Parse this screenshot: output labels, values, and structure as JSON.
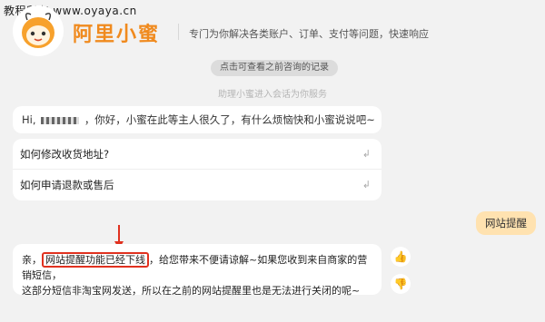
{
  "watermark": "教程所有 www.oyaya.cn",
  "header": {
    "brand": "阿里小蜜",
    "tagline": "专门为你解决各类账户、订单、支付等问题，快速响应"
  },
  "history_button": "点击可查看之前咨询的记录",
  "system_note": "助理小蜜进入会话为你服务",
  "greeting": {
    "prefix": "Hi,",
    "suffix": "，你好，小蜜在此等主人很久了，有什么烦恼快和小蜜说说吧~"
  },
  "faq": [
    {
      "label": "如何修改收货地址?"
    },
    {
      "label": "如何申请退款或售后"
    }
  ],
  "user_message": "网站提醒",
  "reply": {
    "lead": "亲，",
    "highlight": "网站提醒功能已经下线",
    "rest_line1": "，给您带来不便请谅解~如果您收到来自商家的营销短信，",
    "line2": "这部分短信非淘宝网发送，所以在之前的网站提醒里也是无法进行关闭的呢~"
  },
  "colors": {
    "brand": "#f08a1e",
    "user_bubble": "#ffe2b0",
    "annotation": "#e0311f"
  },
  "icons": [
    "bee-mascot-icon",
    "thumbs-up-icon",
    "thumbs-down-icon",
    "link-arrow-icon"
  ]
}
